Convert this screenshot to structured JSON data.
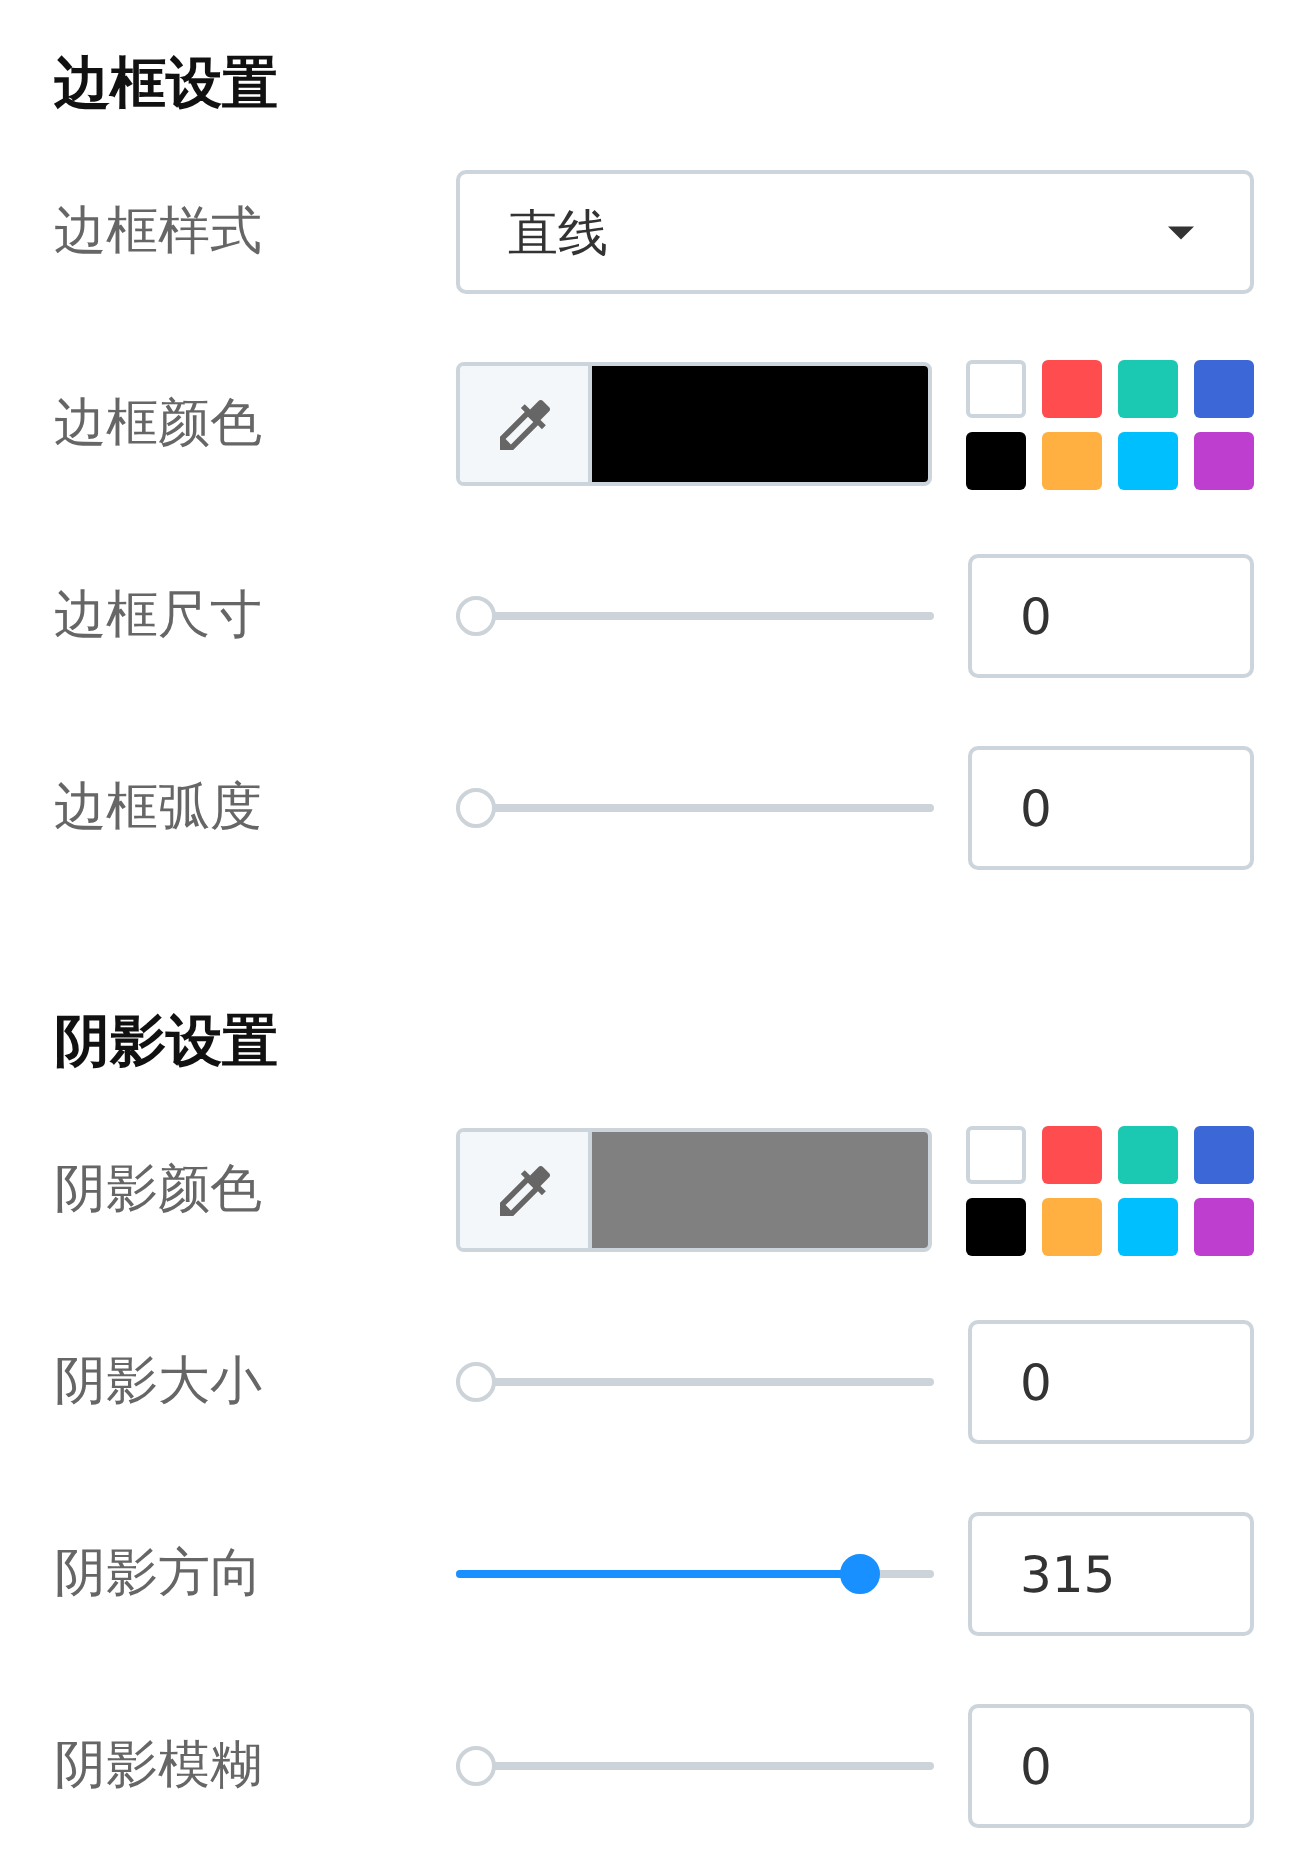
{
  "sections": [
    {
      "title": "边框设置",
      "rows": [
        {
          "kind": "select",
          "label": "边框样式",
          "value": "直线"
        },
        {
          "kind": "color",
          "label": "边框颜色",
          "color": "#000000",
          "swatches": [
            {
              "color": "#ffffff"
            },
            {
              "color": "#ff4d4f"
            },
            {
              "color": "#1bc8b1"
            },
            {
              "color": "#3b68d6"
            },
            {
              "color": "#000000"
            },
            {
              "color": "#ffb040"
            },
            {
              "color": "#00bfff"
            },
            {
              "color": "#be3fcf"
            }
          ]
        },
        {
          "kind": "slider",
          "label": "边框尺寸",
          "level": 0,
          "value": "0"
        },
        {
          "kind": "slider",
          "label": "边框弧度",
          "level": 0,
          "value": "0"
        }
      ]
    },
    {
      "title": "阴影设置",
      "rows": [
        {
          "kind": "color",
          "label": "阴影颜色",
          "color": "#808080",
          "swatches": [
            {
              "color": "#ffffff"
            },
            {
              "color": "#ff4d4f"
            },
            {
              "color": "#1bc8b1"
            },
            {
              "color": "#3b68d6"
            },
            {
              "color": "#000000"
            },
            {
              "color": "#ffb040"
            },
            {
              "color": "#00bfff"
            },
            {
              "color": "#be3fcf"
            }
          ]
        },
        {
          "kind": "slider",
          "label": "阴影大小",
          "level": 0,
          "value": "0"
        },
        {
          "kind": "slider",
          "label": "阴影方向",
          "level": 0.875,
          "value": "315"
        },
        {
          "kind": "slider",
          "label": "阴影模糊",
          "level": 0,
          "value": "0"
        }
      ]
    }
  ]
}
